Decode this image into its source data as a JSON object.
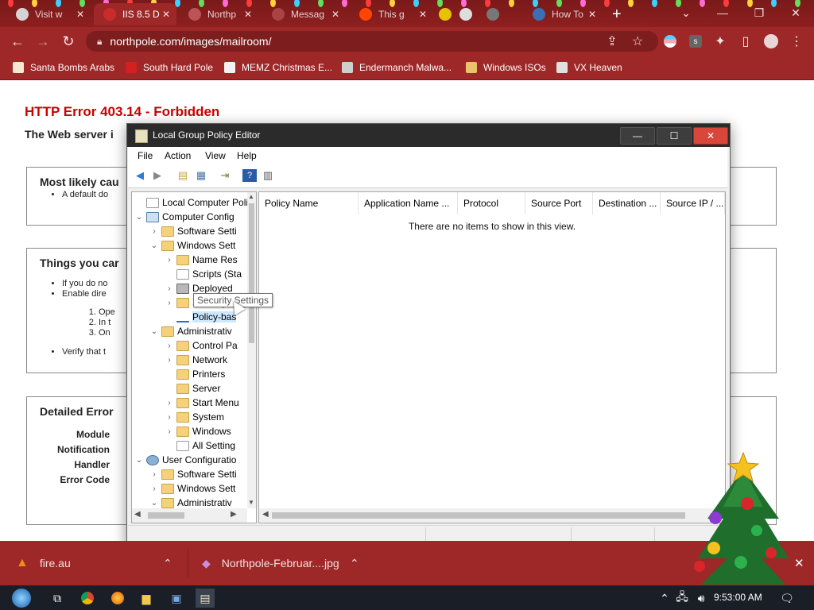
{
  "browser": {
    "tabs": [
      {
        "label": "Visit w",
        "favicon_color": "#d4d4d4"
      },
      {
        "label": "IIS 8.5 D",
        "favicon_color": "#cc2b2b",
        "active": true
      },
      {
        "label": "Northp",
        "favicon_color": "#b55"
      },
      {
        "label": "Messag",
        "favicon_color": "#a44"
      },
      {
        "label": "This g",
        "favicon_color": "#ff4500"
      },
      {
        "label": "",
        "favicon_color": "#e6c200"
      },
      {
        "label": "",
        "favicon_color": "#ddd"
      },
      {
        "label": "",
        "favicon_color": "#777"
      },
      {
        "label": "How To",
        "favicon_color": "#3b6fb6"
      }
    ],
    "close_glyph": "✕",
    "new_tab_glyph": "+",
    "url": "northpole.com/images/mailroom/",
    "bookmarks": [
      {
        "label": "Santa Bombs Arabs",
        "icon_color": "#f5e7d0"
      },
      {
        "label": "South Hard Pole",
        "icon_color": "#d42020"
      },
      {
        "label": "MEMZ Christmas E...",
        "icon_color": "#f2f2f2"
      },
      {
        "label": "Endermanch Malwa...",
        "icon_color": "#cfcfcf"
      },
      {
        "label": "Windows ISOs",
        "icon_color": "#e9c26a"
      },
      {
        "label": "VX Heaven",
        "icon_color": "#e0e0e0"
      }
    ]
  },
  "iis_page": {
    "error_title": "HTTP Error 403.14 - Forbidden",
    "error_subtitle": "The Web server i",
    "most_likely_heading": "Most likely cau",
    "most_likely_items": [
      "A default do"
    ],
    "things_heading": "Things you car",
    "things_items": [
      "If you do no",
      "Enable dire"
    ],
    "things_steps": [
      "Ope",
      "In t",
      "On"
    ],
    "things_last": "Verify that t",
    "detailed_heading": "Detailed Error",
    "detail_labels": [
      "Module",
      "Notification",
      "Handler",
      "Error Code"
    ]
  },
  "gpedit": {
    "title": "Local Group Policy Editor",
    "menu": [
      "File",
      "Action",
      "View",
      "Help"
    ],
    "tree": [
      {
        "label": "Local Computer Polic",
        "level": 0,
        "arrow": "",
        "icon": "doc"
      },
      {
        "label": "Computer Config",
        "level": 0,
        "arrow": "down",
        "icon": "pc"
      },
      {
        "label": "Software Setti",
        "level": 1,
        "arrow": "right",
        "icon": "folder"
      },
      {
        "label": "Windows Sett",
        "level": 1,
        "arrow": "down",
        "icon": "folder"
      },
      {
        "label": "Name Res",
        "level": 2,
        "arrow": "right",
        "icon": "folder"
      },
      {
        "label": "Scripts (Sta",
        "level": 2,
        "arrow": "",
        "icon": "doc"
      },
      {
        "label": "Deployed",
        "level": 2,
        "arrow": "right",
        "icon": "prn"
      },
      {
        "label": "Security Settings",
        "level": 2,
        "arrow": "right",
        "icon": "folder"
      },
      {
        "label": "Policy-bas",
        "level": 2,
        "arrow": "",
        "icon": "bar",
        "selected": true
      },
      {
        "label": "Administrativ",
        "level": 1,
        "arrow": "down",
        "icon": "folder"
      },
      {
        "label": "Control Pa",
        "level": 2,
        "arrow": "right",
        "icon": "folder"
      },
      {
        "label": "Network",
        "level": 2,
        "arrow": "right",
        "icon": "folder"
      },
      {
        "label": "Printers",
        "level": 2,
        "arrow": "",
        "icon": "folder"
      },
      {
        "label": "Server",
        "level": 2,
        "arrow": "",
        "icon": "folder"
      },
      {
        "label": "Start Menu",
        "level": 2,
        "arrow": "right",
        "icon": "folder"
      },
      {
        "label": "System",
        "level": 2,
        "arrow": "right",
        "icon": "folder"
      },
      {
        "label": "Windows",
        "level": 2,
        "arrow": "right",
        "icon": "folder"
      },
      {
        "label": "All Setting",
        "level": 2,
        "arrow": "",
        "icon": "doc"
      },
      {
        "label": "User Configuratio",
        "level": 0,
        "arrow": "down",
        "icon": "user"
      },
      {
        "label": "Software Setti",
        "level": 1,
        "arrow": "right",
        "icon": "folder"
      },
      {
        "label": "Windows Sett",
        "level": 1,
        "arrow": "right",
        "icon": "folder"
      },
      {
        "label": "Administrativ",
        "level": 1,
        "arrow": "down",
        "icon": "folder"
      }
    ],
    "columns": [
      "Policy Name",
      "Application Name ...",
      "Protocol",
      "Source Port",
      "Destination ...",
      "Source IP / ..."
    ],
    "empty_message": "There are no items to show in this view.",
    "tooltip": "Security Settings"
  },
  "downloads": [
    {
      "name": "fire.au",
      "icon": "vlc-cone-icon"
    },
    {
      "name": "Northpole-Februar....jpg",
      "icon": "image-file-icon"
    }
  ],
  "taskbar": {
    "time": "9:53:00 AM"
  },
  "colors": {
    "browser_red": "#9e2727",
    "error_red": "#cc0000",
    "title_dark": "#2b2b2b"
  }
}
